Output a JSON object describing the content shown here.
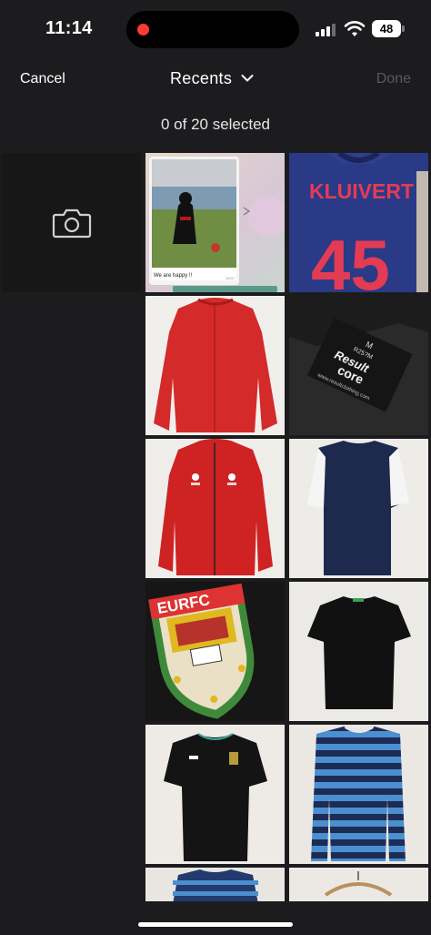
{
  "status_bar": {
    "time": "11:14",
    "battery": "48"
  },
  "nav": {
    "cancel_label": "Cancel",
    "title": "Recents",
    "done_label": "Done"
  },
  "selection": {
    "count_text": "0 of 20 selected"
  },
  "photos": [
    {
      "chat_caption": "We are happy !!",
      "chat_time": "19:07"
    },
    {
      "shirt_name": "KLUIVERT",
      "shirt_number": "45"
    },
    {},
    {
      "label_size": "M",
      "label_code": "R25?M",
      "label_brand": "Result",
      "label_line": "core",
      "label_url": "www.resultclothing.com"
    },
    {},
    {},
    {
      "badge_text": "EURFC"
    },
    {},
    {},
    {}
  ],
  "colors": {
    "background": "#1c1c1e",
    "done_disabled": "#5a5a5d",
    "recording_dot": "#ff3b30"
  }
}
